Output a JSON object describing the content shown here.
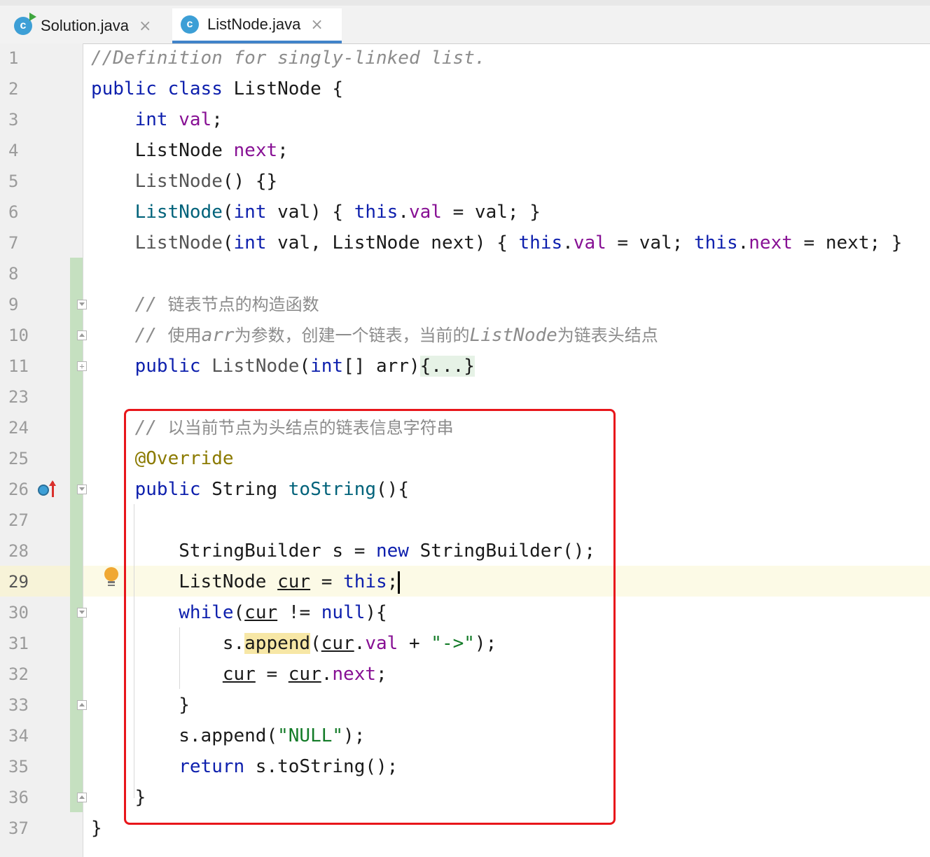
{
  "tabs": [
    {
      "label": "Solution.java",
      "icon": "c",
      "active": false
    },
    {
      "label": "ListNode.java",
      "icon": "c",
      "active": true
    }
  ],
  "line_numbers": [
    "1",
    "2",
    "3",
    "4",
    "5",
    "6",
    "7",
    "8",
    "9",
    "10",
    "11",
    "23",
    "24",
    "25",
    "26",
    "27",
    "28",
    "29",
    "30",
    "31",
    "32",
    "33",
    "34",
    "35",
    "36",
    "37"
  ],
  "code": {
    "l1": "//Definition for singly-linked list.",
    "l2_kw1": "public",
    "l2_kw2": "class",
    "l2_name": "ListNode",
    "l2_brace": "{",
    "l3_type": "int",
    "l3_field": "val",
    "l3_semi": ";",
    "l4_type": "ListNode",
    "l4_field": "next",
    "l4_semi": ";",
    "l5_ctor": "ListNode",
    "l5_rest": "() {}",
    "l6_ctor": "ListNode",
    "l6_p1": "(",
    "l6_int": "int",
    "l6_p2": " val) { ",
    "l6_this": "this",
    "l6_dot": ".",
    "l6_val": "val",
    "l6_p3": " = val; }",
    "l7_ctor": "ListNode",
    "l7_p1": "(",
    "l7_int": "int",
    "l7_p2": " val, ListNode next) { ",
    "l7_this1": "this",
    "l7_dot1": ".",
    "l7_val": "val",
    "l7_p3": " = val; ",
    "l7_this2": "this",
    "l7_dot2": ".",
    "l7_next": "next",
    "l7_p4": " = next; }",
    "l9_slash": "// ",
    "l9_text": "链表节点的构造函数",
    "l10_slash": "// ",
    "l10_text1": "使用",
    "l10_arr": "arr",
    "l10_text2": "为参数，创建一个链表，当前的",
    "l10_cls": "ListNode",
    "l10_text3": "为链表头结点",
    "l11_kw": "public",
    "l11_ctor": "ListNode",
    "l11_p1": "(",
    "l11_int": "int",
    "l11_p2": "[] arr)",
    "l11_fold": "{...}",
    "l24_slash": "// ",
    "l24_text": "以当前节点为头结点的链表信息字符串",
    "l25_ann": "@Override",
    "l26_kw": "public",
    "l26_type": " String ",
    "l26_mth": "toString",
    "l26_rest": "(){",
    "l28_a": "StringBuilder s = ",
    "l28_new": "new",
    "l28_b": " StringBuilder();",
    "l29_a": "ListNode ",
    "l29_cur": "cur",
    "l29_b": " = ",
    "l29_this": "this",
    "l29_semi": ";",
    "l30_while": "while",
    "l30_p1": "(",
    "l30_cur": "cur",
    "l30_p2": " != ",
    "l30_null": "null",
    "l30_p3": "){",
    "l31_a": "s.",
    "l31_append": "append",
    "l31_p1": "(",
    "l31_cur": "cur",
    "l31_dot": ".",
    "l31_val": "val",
    "l31_plus": " + ",
    "l31_str": "\"->\"",
    "l31_end": ");",
    "l32_cur1": "cur",
    "l32_eq": " = ",
    "l32_cur2": "cur",
    "l32_dot": ".",
    "l32_next": "next",
    "l32_semi": ";",
    "l33": "}",
    "l34_a": "s.append(",
    "l34_str": "\"NULL\"",
    "l34_b": ");",
    "l35_kw": "return",
    "l35_rest": " s.toString();",
    "l36": "}",
    "l37": "}"
  },
  "colors": {
    "keyword": "#0d1fad",
    "field": "#871094",
    "comment": "#8c8c8c",
    "annotation": "#8b7a00",
    "string": "#137b28",
    "method": "#00627a",
    "highlight_box": "#e8161b",
    "current_line": "#fcfae6"
  },
  "icons": {
    "tab_icon": "class-c-icon",
    "override": "overrides-method-icon",
    "intention": "lightbulb-icon"
  },
  "current_line": "29"
}
